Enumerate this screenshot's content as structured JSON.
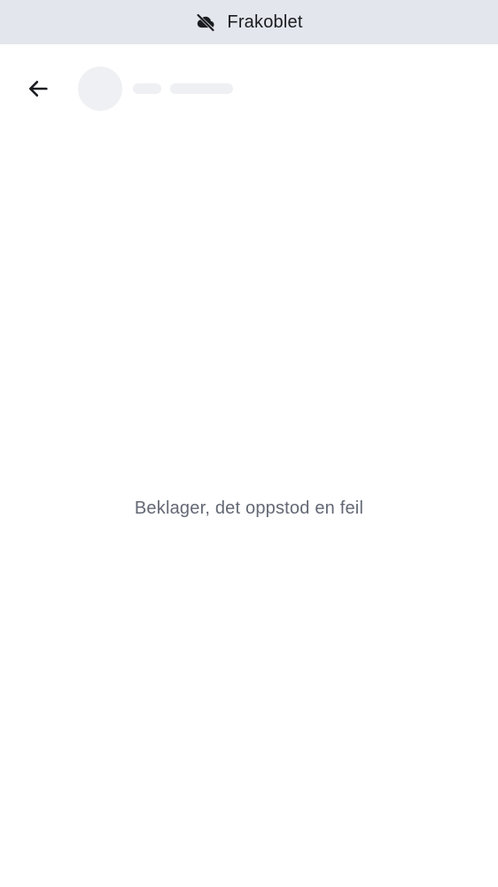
{
  "status_banner": {
    "label": "Frakoblet",
    "icon": "cloud-off-icon",
    "background": "#e3e6ec"
  },
  "header": {
    "back_icon": "arrow-left-icon"
  },
  "main": {
    "error_message": "Beklager, det oppstod en feil"
  }
}
